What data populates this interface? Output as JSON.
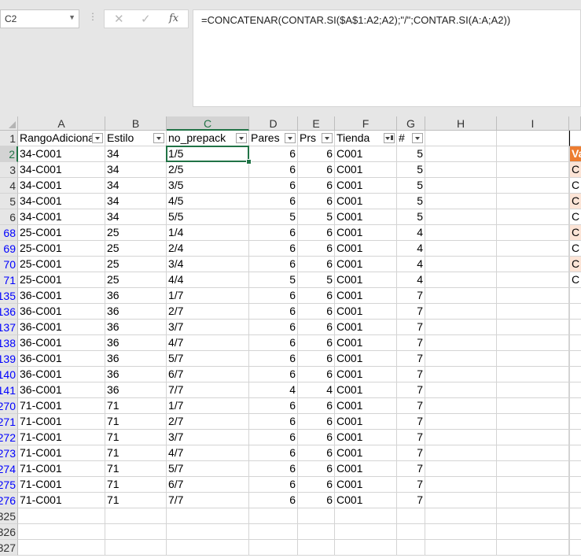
{
  "name_box": {
    "value": "C2"
  },
  "formula_bar": {
    "cancel_glyph": "✕",
    "enter_glyph": "✓",
    "fx_label": "fx",
    "formula": "=CONCATENAR(CONTAR.SI($A$1:A2;A2);\"/\";CONTAR.SI(A:A;A2))"
  },
  "columns": [
    "A",
    "B",
    "C",
    "D",
    "E",
    "F",
    "G",
    "H",
    "I"
  ],
  "selected_column": "C",
  "header_row": {
    "row_label": "1",
    "cells": [
      "RangoAdicional",
      "Estilo",
      "no_prepack",
      "Pares",
      "Prs",
      "Tienda",
      "#"
    ]
  },
  "rows": [
    {
      "label": "2",
      "cells": [
        "34-C001",
        "34",
        "1/5",
        "6",
        "6",
        "C001",
        "5"
      ]
    },
    {
      "label": "3",
      "cells": [
        "34-C001",
        "34",
        "2/5",
        "6",
        "6",
        "C001",
        "5"
      ]
    },
    {
      "label": "4",
      "cells": [
        "34-C001",
        "34",
        "3/5",
        "6",
        "6",
        "C001",
        "5"
      ]
    },
    {
      "label": "5",
      "cells": [
        "34-C001",
        "34",
        "4/5",
        "6",
        "6",
        "C001",
        "5"
      ]
    },
    {
      "label": "6",
      "cells": [
        "34-C001",
        "34",
        "5/5",
        "5",
        "5",
        "C001",
        "5"
      ]
    },
    {
      "label": "68",
      "cells": [
        "25-C001",
        "25",
        "1/4",
        "6",
        "6",
        "C001",
        "4"
      ]
    },
    {
      "label": "69",
      "cells": [
        "25-C001",
        "25",
        "2/4",
        "6",
        "6",
        "C001",
        "4"
      ]
    },
    {
      "label": "70",
      "cells": [
        "25-C001",
        "25",
        "3/4",
        "6",
        "6",
        "C001",
        "4"
      ]
    },
    {
      "label": "71",
      "cells": [
        "25-C001",
        "25",
        "4/4",
        "5",
        "5",
        "C001",
        "4"
      ]
    },
    {
      "label": "135",
      "cells": [
        "36-C001",
        "36",
        "1/7",
        "6",
        "6",
        "C001",
        "7"
      ]
    },
    {
      "label": "136",
      "cells": [
        "36-C001",
        "36",
        "2/7",
        "6",
        "6",
        "C001",
        "7"
      ]
    },
    {
      "label": "137",
      "cells": [
        "36-C001",
        "36",
        "3/7",
        "6",
        "6",
        "C001",
        "7"
      ]
    },
    {
      "label": "138",
      "cells": [
        "36-C001",
        "36",
        "4/7",
        "6",
        "6",
        "C001",
        "7"
      ]
    },
    {
      "label": "139",
      "cells": [
        "36-C001",
        "36",
        "5/7",
        "6",
        "6",
        "C001",
        "7"
      ]
    },
    {
      "label": "140",
      "cells": [
        "36-C001",
        "36",
        "6/7",
        "6",
        "6",
        "C001",
        "7"
      ]
    },
    {
      "label": "141",
      "cells": [
        "36-C001",
        "36",
        "7/7",
        "4",
        "4",
        "C001",
        "7"
      ]
    },
    {
      "label": "270",
      "cells": [
        "71-C001",
        "71",
        "1/7",
        "6",
        "6",
        "C001",
        "7"
      ]
    },
    {
      "label": "271",
      "cells": [
        "71-C001",
        "71",
        "2/7",
        "6",
        "6",
        "C001",
        "7"
      ]
    },
    {
      "label": "272",
      "cells": [
        "71-C001",
        "71",
        "3/7",
        "6",
        "6",
        "C001",
        "7"
      ]
    },
    {
      "label": "273",
      "cells": [
        "71-C001",
        "71",
        "4/7",
        "6",
        "6",
        "C001",
        "7"
      ]
    },
    {
      "label": "274",
      "cells": [
        "71-C001",
        "71",
        "5/7",
        "6",
        "6",
        "C001",
        "7"
      ]
    },
    {
      "label": "275",
      "cells": [
        "71-C001",
        "71",
        "6/7",
        "6",
        "6",
        "C001",
        "7"
      ]
    },
    {
      "label": "276",
      "cells": [
        "71-C001",
        "71",
        "7/7",
        "6",
        "6",
        "C001",
        "7"
      ]
    }
  ],
  "empty_rows": [
    "325",
    "326",
    "327"
  ],
  "right_edge_cells": [
    "Va",
    "C",
    "C",
    "C",
    "C",
    "C",
    "C",
    "C",
    "C"
  ],
  "colors": {
    "selection": "#217346",
    "row_number_filtered": "#0000ff",
    "edge_header_bg": "#ed7d31",
    "edge_cell_bg": "#fce4d6"
  }
}
